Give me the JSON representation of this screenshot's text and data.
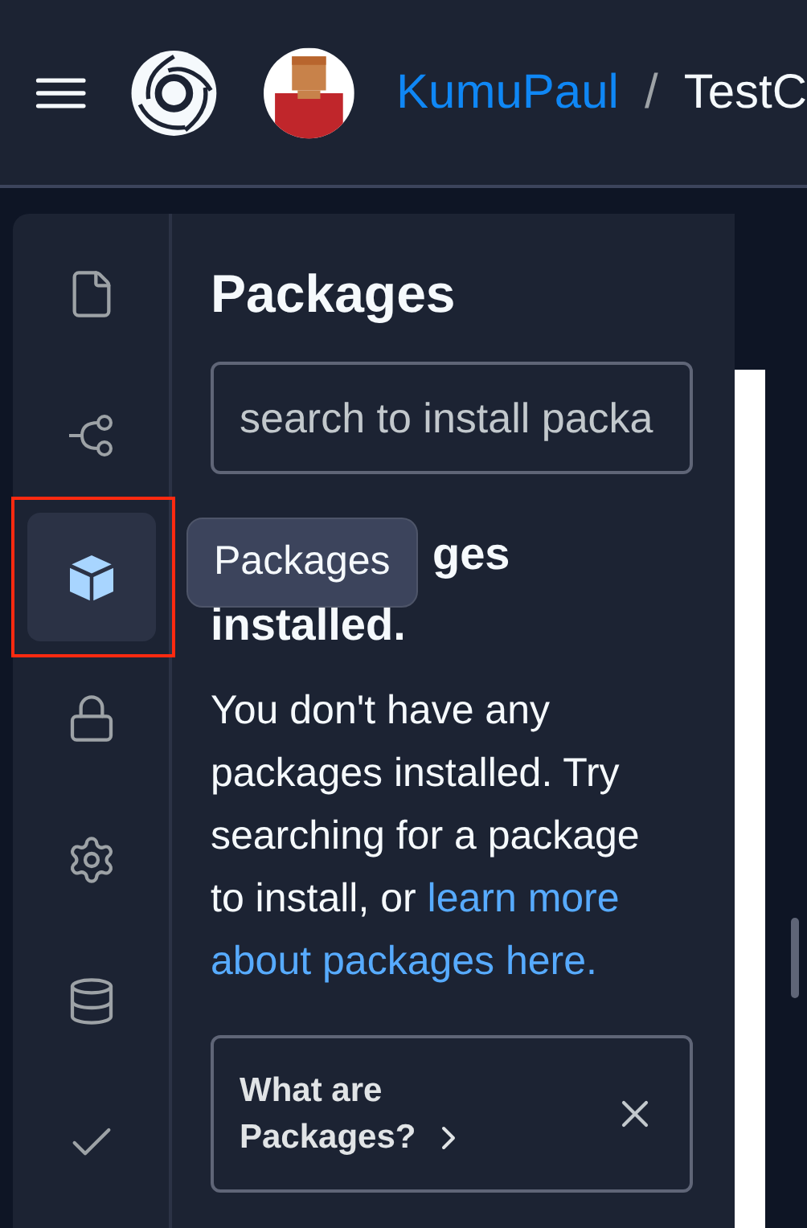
{
  "header": {
    "owner": "KumuPaul",
    "separator": "/",
    "repl": "TestC"
  },
  "rail": [
    {
      "kind": "file",
      "selected": false
    },
    {
      "kind": "branch",
      "selected": false
    },
    {
      "kind": "package",
      "selected": true,
      "highlighted": true
    },
    {
      "kind": "lock",
      "selected": false
    },
    {
      "kind": "gear",
      "selected": false
    },
    {
      "kind": "database",
      "selected": false
    },
    {
      "kind": "check",
      "selected": false
    }
  ],
  "tooltip": "Packages",
  "panel": {
    "title": "Packages",
    "search": {
      "placeholder": "search to install packa"
    },
    "empty_heading": [
      "ges",
      "installed."
    ],
    "message": "You don't have any packages installed. Try searching for a package to install, or ",
    "link": [
      "learn more",
      "about packages here."
    ],
    "card": {
      "title": "What are Packages?"
    }
  }
}
